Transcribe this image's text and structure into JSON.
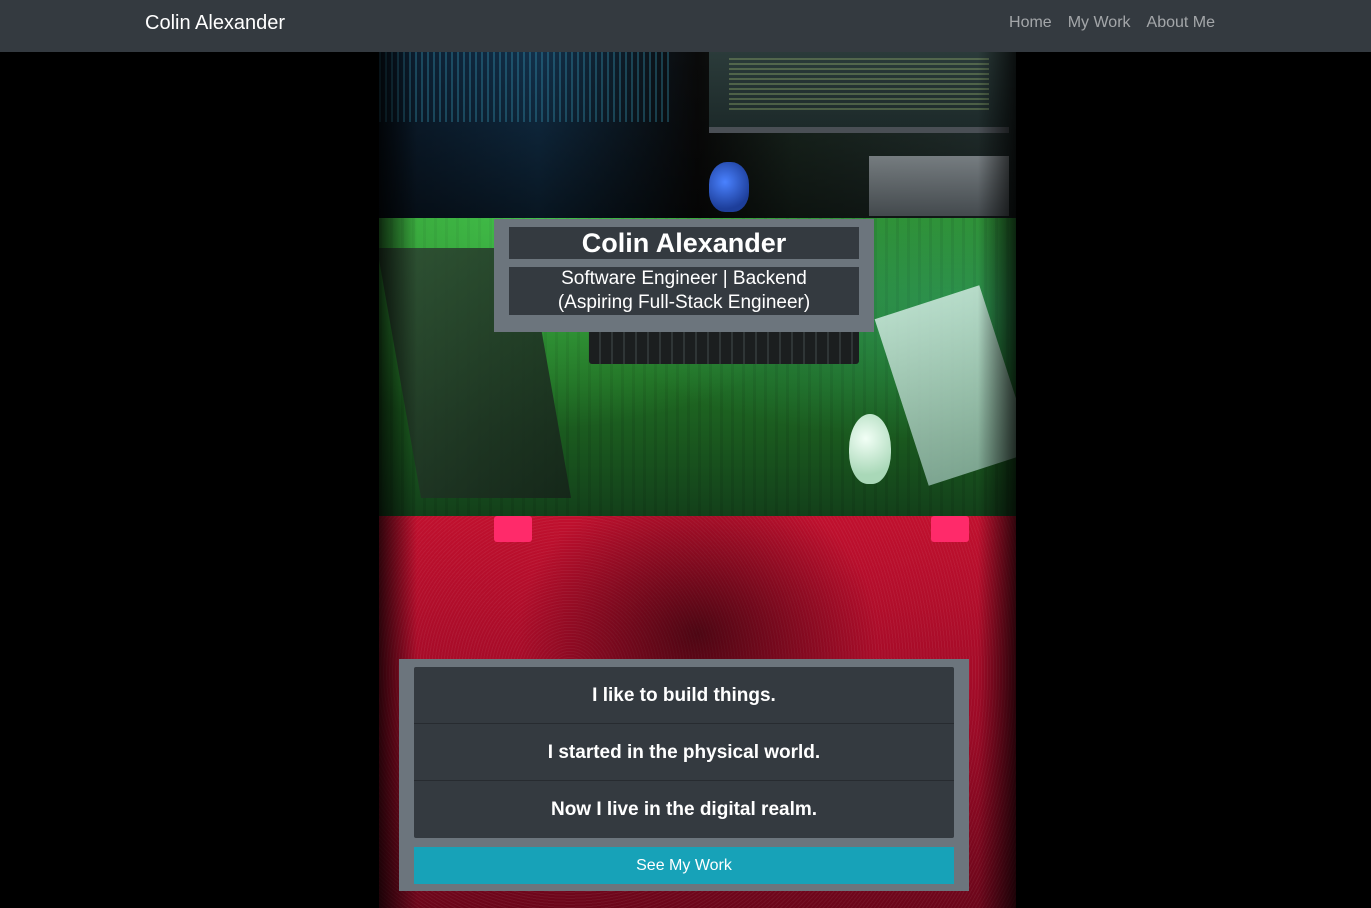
{
  "navbar": {
    "brand": "Colin Alexander",
    "links": [
      "Home",
      "My Work",
      "About Me"
    ]
  },
  "hero": {
    "title": "Colin Alexander",
    "subtitle_line1": "Software Engineer | Backend",
    "subtitle_line2": "(Aspiring Full-Stack Engineer)"
  },
  "intro": {
    "lines": [
      "I like to build things.",
      "I started in the physical world.",
      "Now I live in the digital realm."
    ],
    "button_label": "See My Work"
  },
  "colors": {
    "navbar_bg": "#343a40",
    "card_bg": "#6c757d",
    "panel_bg": "#343a40",
    "button_bg": "#17a2b8",
    "page_bg": "#000000"
  }
}
